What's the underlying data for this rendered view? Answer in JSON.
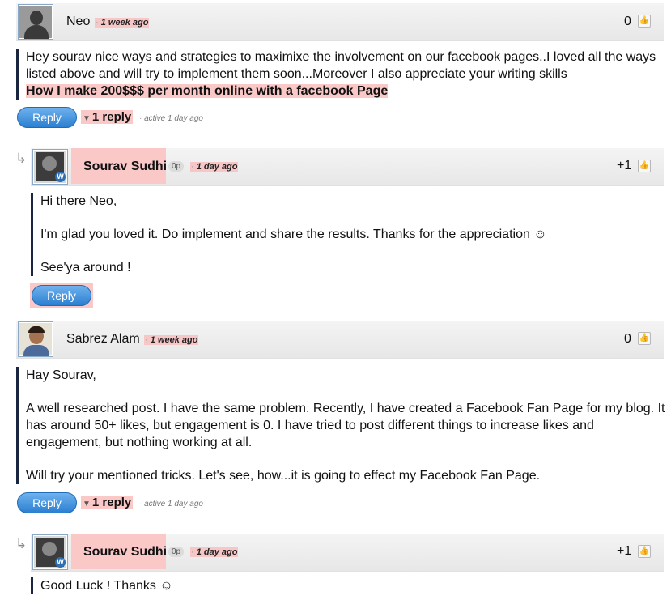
{
  "comments": [
    {
      "author": "Neo",
      "time": "1 week ago",
      "score": "0",
      "body": [
        "Hey sourav nice ways and strategies to maximixe the involvement on our facebook pages..I loved all the ways listed above and will try to implement them soon...Moreover I also appreciate your writing skills"
      ],
      "promo_link": "How I make 200$$$ per month online with a facebook Page",
      "reply_label": "Reply",
      "replies_toggle": "1 reply",
      "activity": "active 1 day ago"
    },
    {
      "author": "Sourav Sudhi",
      "badge": "0p",
      "time": "1 day ago",
      "score": "+1",
      "body": [
        "Hi there Neo,",
        "I'm glad you loved it. Do implement and share the results. Thanks for the appreciation ☺",
        "See'ya around !"
      ],
      "reply_label": "Reply"
    },
    {
      "author": "Sabrez Alam",
      "time": "1 week ago",
      "score": "0",
      "body": [
        "Hay Sourav,",
        "A well researched post. I have the same problem. Recently, I have created a Facebook Fan Page for my blog. It has around 50+ likes, but engagement is 0. I have tried to post different things to increase likes and engagement, but nothing working at all.",
        "Will try your mentioned tricks. Let's see, how...it is going to effect my Facebook Fan Page."
      ],
      "reply_label": "Reply",
      "replies_toggle": "1 reply",
      "activity": "active 1 day ago"
    },
    {
      "author": "Sourav Sudhi",
      "badge": "0p",
      "time": "1 day ago",
      "score": "+1",
      "body": [
        "Good Luck ! Thanks ☺"
      ]
    }
  ],
  "icons": {
    "like": "thumbs-up-icon",
    "reply_arrow": "reply-arrow-icon",
    "toggle": "triangle-down-icon",
    "wordpress": "wordpress-icon"
  },
  "colors": {
    "highlight": "#fbc8c8",
    "button": "#2b7fd1",
    "quote_bar": "#1a2540"
  }
}
